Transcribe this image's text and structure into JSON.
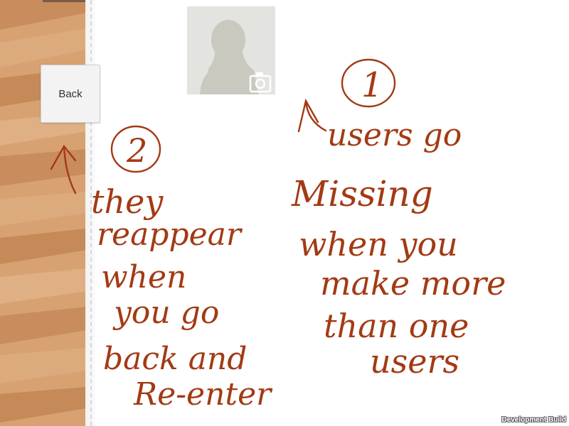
{
  "back_button": {
    "label": "Back"
  },
  "avatar": {
    "icon": "user-silhouette-icon",
    "camera_icon": "camera-icon"
  },
  "annotations": {
    "note1": {
      "number": "1",
      "lines": [
        "users go",
        "Missing",
        "when you",
        "make more",
        "than one",
        "users"
      ]
    },
    "note2": {
      "number": "2",
      "lines": [
        "they",
        "reappear",
        "when",
        "you go",
        "back and",
        "Re-enter"
      ]
    },
    "ink_color": "#a33a14"
  },
  "footer": {
    "build_label": "Development Build"
  },
  "colors": {
    "wood_light": "#d7a171",
    "wood_dark": "#c88b5a",
    "ink": "#a33a14"
  }
}
